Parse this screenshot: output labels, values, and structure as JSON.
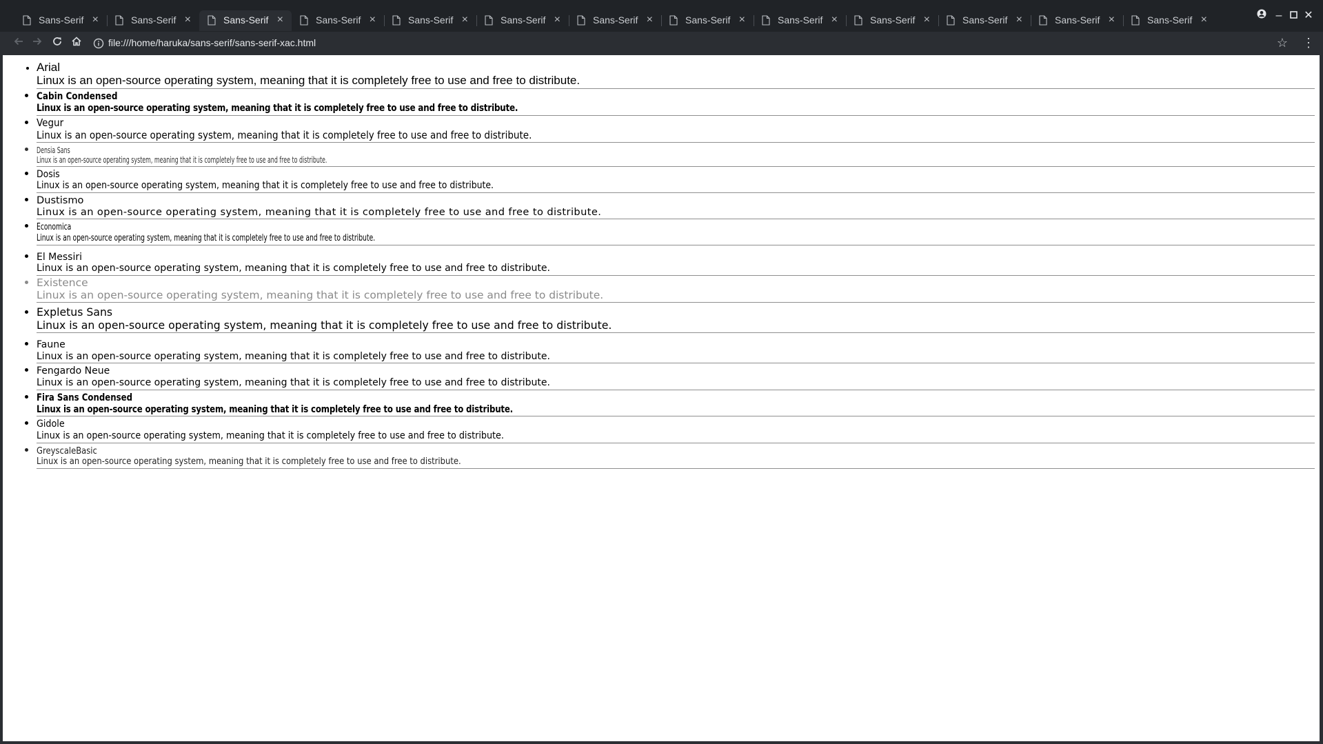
{
  "browser": {
    "tabs": [
      {
        "title": "Sans-Serif",
        "active": false
      },
      {
        "title": "Sans-Serif",
        "active": false
      },
      {
        "title": "Sans-Serif",
        "active": true
      },
      {
        "title": "Sans-Serif",
        "active": false
      },
      {
        "title": "Sans-Serif",
        "active": false
      },
      {
        "title": "Sans-Serif",
        "active": false
      },
      {
        "title": "Sans-Serif",
        "active": false
      },
      {
        "title": "Sans-Serif",
        "active": false
      },
      {
        "title": "Sans-Serif",
        "active": false
      },
      {
        "title": "Sans-Serif",
        "active": false
      },
      {
        "title": "Sans-Serif",
        "active": false
      },
      {
        "title": "Sans-Serif",
        "active": false
      },
      {
        "title": "Sans-Serif",
        "active": false
      }
    ],
    "tab_close_glyph": "×",
    "url": "file:///home/haruka/sans-serif/sans-serif-xac.html",
    "icons": {
      "back": "back-arrow-icon",
      "forward": "forward-arrow-icon",
      "reload": "reload-icon",
      "home": "home-icon",
      "info": "info-icon",
      "bookmark": "star-icon",
      "menu": "menu-dots-icon",
      "profile": "profile-icon",
      "minimize": "minimize-icon",
      "maximize": "maximize-icon",
      "close": "close-icon"
    },
    "colors": {
      "tabstrip": "#202327",
      "toolbar": "#2b2e33",
      "page": "#ffffff"
    }
  },
  "page": {
    "sample_text": "Linux is an open-source operating system, meaning that it is completely free to use and free to distribute.",
    "fonts": [
      {
        "name": "Arial"
      },
      {
        "name": "Cabin Condensed"
      },
      {
        "name": "Vegur"
      },
      {
        "name": "Densia Sans"
      },
      {
        "name": "Dosis"
      },
      {
        "name": "Dustismo"
      },
      {
        "name": "Economica"
      },
      {
        "name": "El Messiri"
      },
      {
        "name": "Existence"
      },
      {
        "name": "Expletus Sans"
      },
      {
        "name": "Faune"
      },
      {
        "name": "Fengardo Neue"
      },
      {
        "name": "Fira Sans Condensed"
      },
      {
        "name": "Gidole"
      },
      {
        "name": "GreyscaleBasic"
      }
    ]
  }
}
